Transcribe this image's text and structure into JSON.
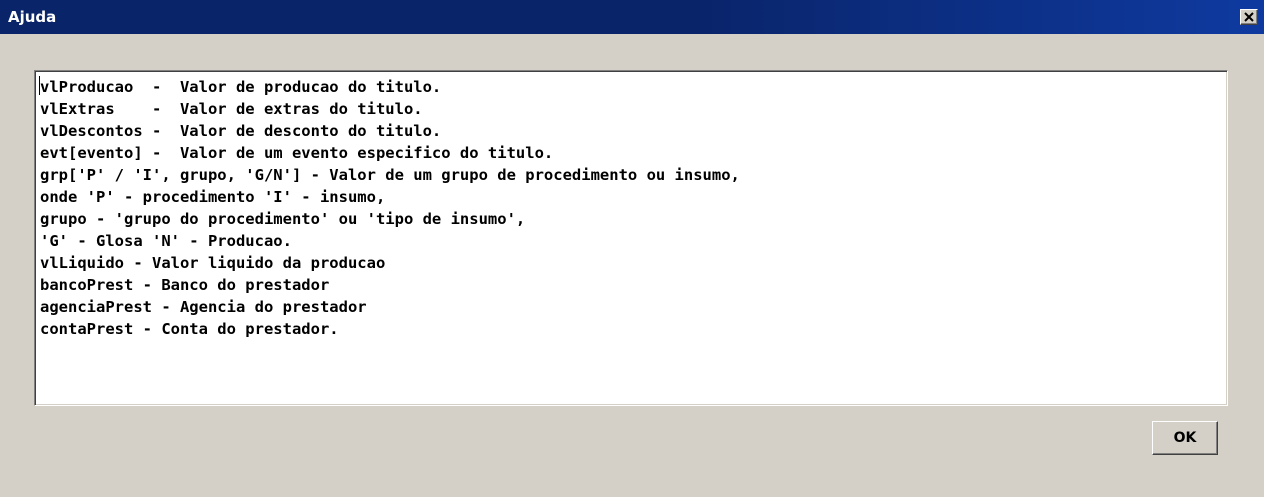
{
  "window": {
    "title": "Ajuda",
    "close_icon": "close-icon"
  },
  "help_text": {
    "lines": [
      "vlProducao  -  Valor de producao do titulo.",
      "vlExtras    -  Valor de extras do titulo.",
      "vlDescontos -  Valor de desconto do titulo.",
      "evt[evento] -  Valor de um evento especifico do titulo.",
      "grp['P' / 'I', grupo, 'G/N'] - Valor de um grupo de procedimento ou insumo,",
      "onde 'P' - procedimento 'I' - insumo,",
      "grupo - 'grupo do procedimento' ou 'tipo de insumo',",
      "'G' - Glosa 'N' - Producao.",
      "vlLiquido - Valor liquido da producao",
      "bancoPrest - Banco do prestador",
      "agenciaPrest - Agencia do prestador",
      "contaPrest - Conta do prestador."
    ]
  },
  "buttons": {
    "ok_label": "OK"
  },
  "colors": {
    "titlebar": "#0a246a",
    "dialog_background": "#d4d0c8",
    "memo_background": "#ffffff"
  }
}
